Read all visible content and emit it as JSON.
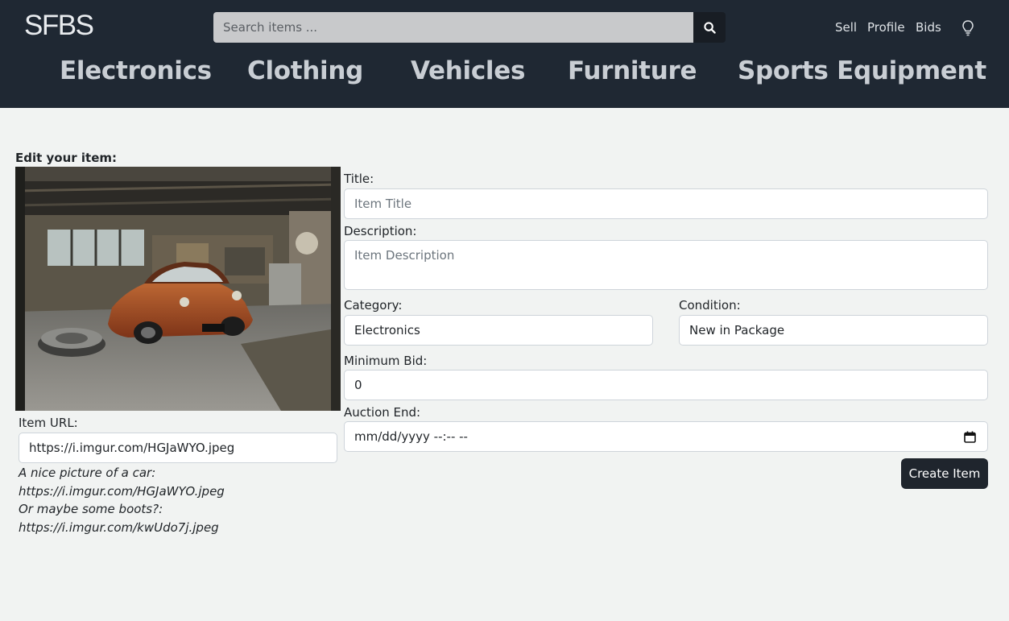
{
  "header": {
    "logo": "SFBS",
    "search_placeholder": "Search items ...",
    "nav": {
      "sell": "Sell",
      "profile": "Profile",
      "bids": "Bids"
    }
  },
  "categories": [
    "Electronics",
    "Clothing",
    "Vehicles",
    "Furniture",
    "Sports Equipment"
  ],
  "form": {
    "heading": "Edit your item:",
    "item_url_label": "Item URL:",
    "item_url_value": "https://i.imgur.com/HGJaWYO.jpeg",
    "hints": [
      "A nice picture of a car:",
      "https://i.imgur.com/HGJaWYO.jpeg",
      "Or maybe some boots?:",
      "https://i.imgur.com/kwUdo7j.jpeg"
    ],
    "title_label": "Title:",
    "title_placeholder": "Item Title",
    "description_label": "Description:",
    "description_placeholder": "Item Description",
    "category_label": "Category:",
    "category_value": "Electronics",
    "condition_label": "Condition:",
    "condition_value": "New in Package",
    "min_bid_label": "Minimum Bid:",
    "min_bid_value": "0",
    "auction_end_label": "Auction End:",
    "auction_end_value": "mm/dd/yyyy --:-- --",
    "submit_label": "Create Item"
  },
  "colors": {
    "header_bg": "#1f2833",
    "page_bg": "#f1f3f2",
    "button_bg": "#1f252d"
  }
}
